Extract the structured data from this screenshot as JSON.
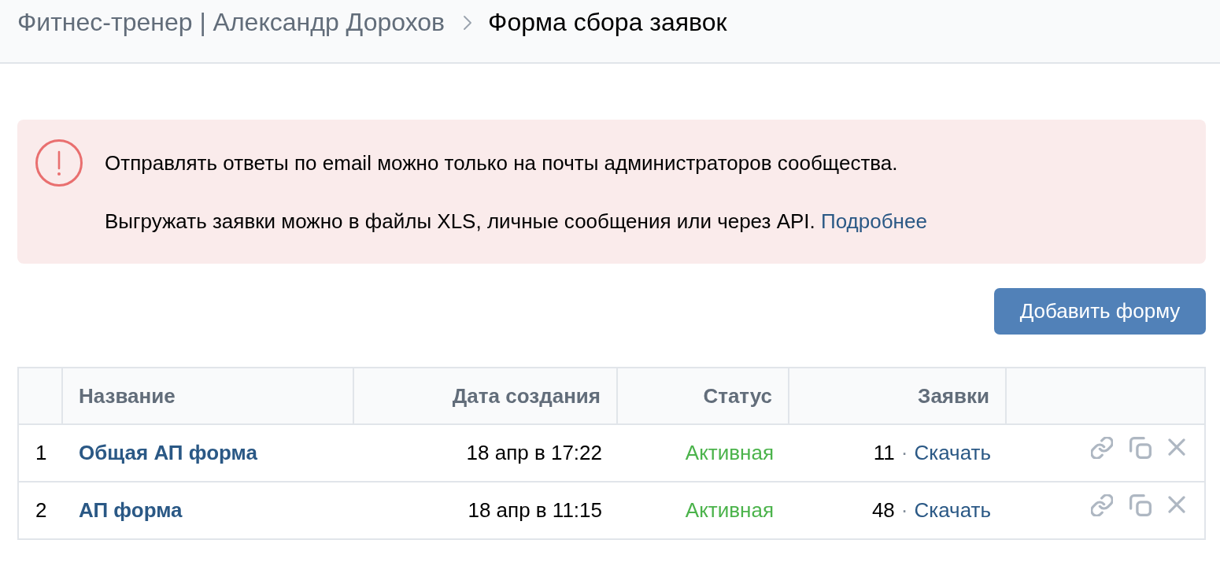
{
  "breadcrumb": {
    "parent": "Фитнес-тренер | Александр Дорохов",
    "current": "Форма сбора заявок"
  },
  "alert": {
    "paragraphs": [
      {
        "text": "Отправлять ответы по email можно только на почты администраторов сообщества."
      },
      {
        "text": "Выгружать заявки можно в файлы XLS, личные сообщения или через API.",
        "link": "Подробнее"
      }
    ]
  },
  "add_button": {
    "label": "Добавить форму"
  },
  "table": {
    "columns": [
      "Название",
      "Дата создания",
      "Статус",
      "Заявки"
    ],
    "rows": [
      {
        "number": "1",
        "name": "Общая АП форма",
        "created": "18 апр в 17:22",
        "status": "Активная",
        "requests": "11",
        "separator": "·",
        "download": "Скачать"
      },
      {
        "number": "2",
        "name": "АП форма",
        "created": "18 апр в 11:15",
        "status": "Активная",
        "requests": "48",
        "separator": "·",
        "download": "Скачать"
      }
    ]
  }
}
